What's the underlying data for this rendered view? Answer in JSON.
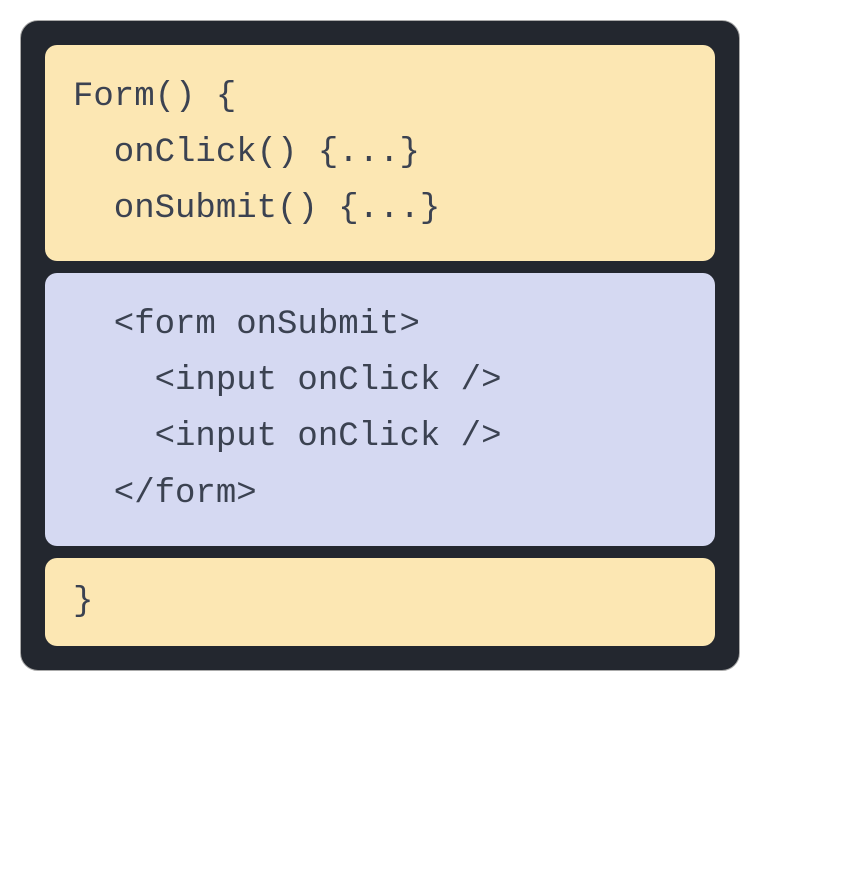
{
  "blocks": {
    "top": {
      "line1": "Form() {",
      "line2": "  onClick() {...}",
      "line3": "  onSubmit() {...}"
    },
    "middle": {
      "line1": "  <form onSubmit>",
      "line2": "    <input onClick />",
      "line3": "    <input onClick />",
      "line4": "  </form>"
    },
    "bottom": {
      "line1": "}"
    }
  }
}
